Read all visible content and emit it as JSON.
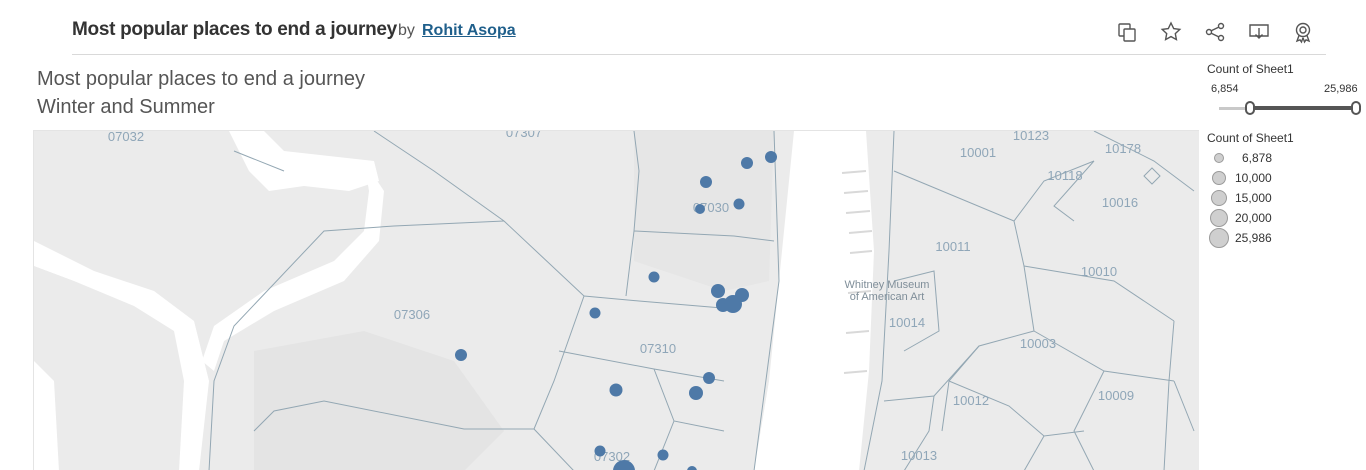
{
  "header": {
    "viz_title": "Most popular places to end a journey",
    "by": "by",
    "author": "Rohit Asopa"
  },
  "toolbar": {
    "icons": [
      "duplicate-icon",
      "star-icon",
      "share-icon",
      "download-icon",
      "badge-icon"
    ]
  },
  "sheet": {
    "title_line1": "Most popular places to end a journey",
    "title_line2": "Winter and Summer"
  },
  "filter": {
    "title": "Count of Sheet1",
    "min": "6,854",
    "max": "25,986"
  },
  "legend": {
    "title": "Count of Sheet1",
    "items": [
      "6,878",
      "10,000",
      "15,000",
      "20,000",
      "25,986"
    ]
  },
  "map": {
    "zip_labels": [
      "07032",
      "07307",
      "07030",
      "07306",
      "07310",
      "07302",
      "10123",
      "10001",
      "10178",
      "10118",
      "10016",
      "10011",
      "10010",
      "10014",
      "10003",
      "10012",
      "10009",
      "10013"
    ],
    "poi": "Whitney Museum\nof American Art",
    "poi_line1": "Whitney Museum",
    "poi_line2": "of American Art",
    "mark_color": "#4e79a7"
  }
}
